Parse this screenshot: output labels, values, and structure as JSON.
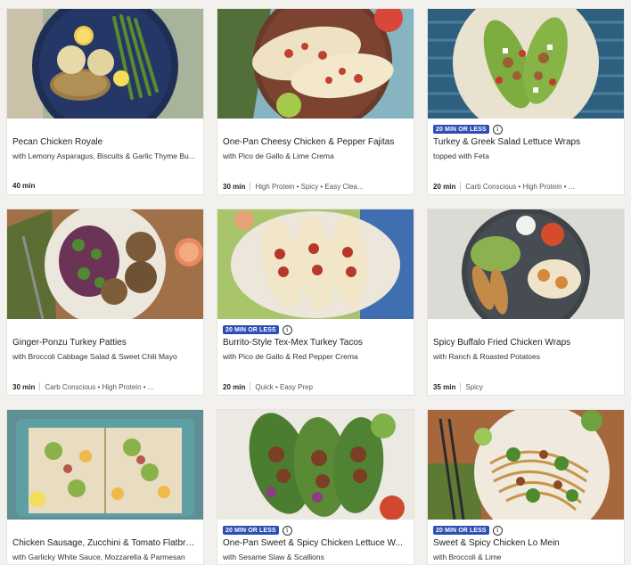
{
  "badges": {
    "quick": "20 MIN OR LESS"
  },
  "recipes": [
    {
      "title": "Pecan Chicken Royale",
      "subtitle": "with Lemony Asparagus, Biscuits & Garlic Thyme Bu...",
      "time": "40 min",
      "tags": "",
      "badge": ""
    },
    {
      "title": "One-Pan Cheesy Chicken & Pepper Fajitas",
      "subtitle": "with Pico de Gallo & Lime Crema",
      "time": "30 min",
      "tags": "High Protein • Spicy • Easy Clea...",
      "badge": ""
    },
    {
      "title": "Turkey & Greek Salad Lettuce Wraps",
      "subtitle": "topped with Feta",
      "time": "20 min",
      "tags": "Carb Conscious • High Protein • ...",
      "badge": "20 MIN OR LESS"
    },
    {
      "title": "Ginger-Ponzu Turkey Patties",
      "subtitle": "with Broccoli Cabbage Salad & Sweet Chili Mayo",
      "time": "30 min",
      "tags": "Carb Conscious • High Protein • ...",
      "badge": ""
    },
    {
      "title": "Burrito-Style Tex-Mex Turkey Tacos",
      "subtitle": "with Pico de Gallo & Red Pepper Crema",
      "time": "20 min",
      "tags": "Quick • Easy Prep",
      "badge": "20 MIN OR LESS"
    },
    {
      "title": "Spicy Buffalo Fried Chicken Wraps",
      "subtitle": "with Ranch & Roasted Potatoes",
      "time": "35 min",
      "tags": "Spicy",
      "badge": ""
    },
    {
      "title": "Chicken Sausage, Zucchini & Tomato Flatbre...",
      "subtitle": "with Garlicky White Sauce, Mozzarella & Parmesan",
      "time": "",
      "tags": "",
      "badge": ""
    },
    {
      "title": "One-Pan Sweet & Spicy Chicken Lettuce W...",
      "subtitle": "with Sesame Slaw & Scallions",
      "time": "",
      "tags": "",
      "badge": "20 MIN OR LESS"
    },
    {
      "title": "Sweet & Spicy Chicken Lo Mein",
      "subtitle": "with Broccoli & Lime",
      "time": "",
      "tags": "",
      "badge": "20 MIN OR LESS"
    }
  ]
}
